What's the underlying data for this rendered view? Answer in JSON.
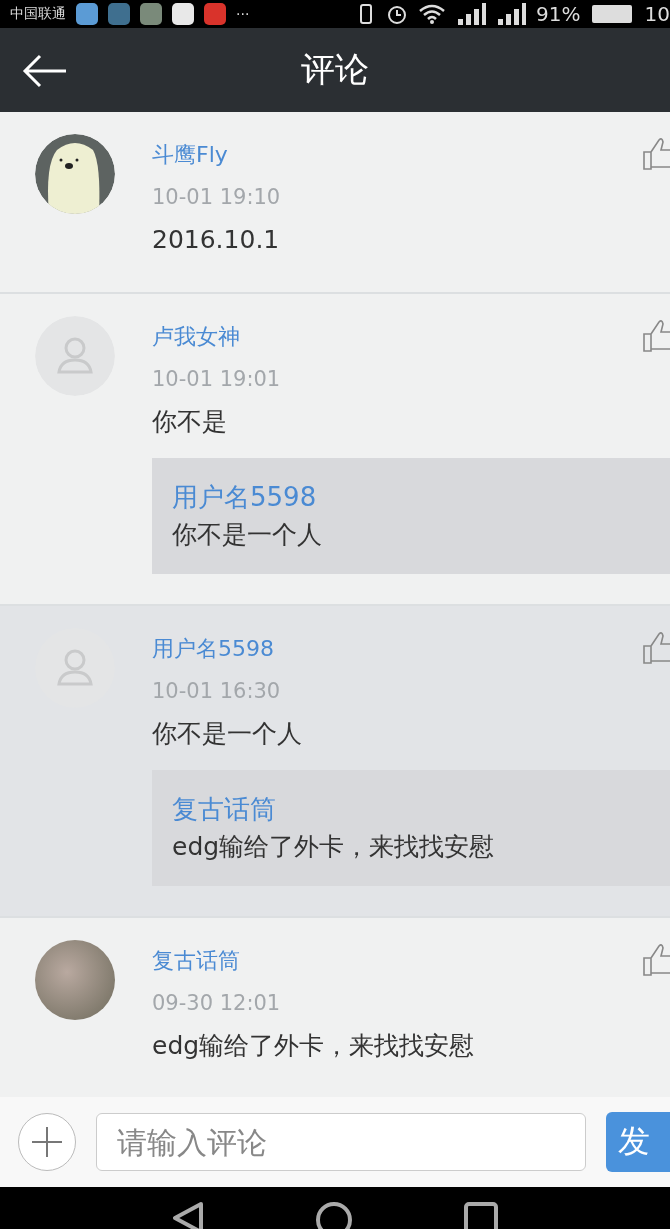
{
  "status_bar": {
    "carrier": "中国联通",
    "more": "···",
    "battery": "91%",
    "time": "10"
  },
  "header": {
    "title": "评论"
  },
  "comments": [
    {
      "author": "斗鹰Fly",
      "time": "10-01 19:10",
      "text": "2016.10.1",
      "avatar": {
        "kind": "cartoon"
      },
      "highlighted": false
    },
    {
      "author": "卢我女神",
      "time": "10-01 19:01",
      "text": "你不是",
      "avatar": {
        "kind": "default"
      },
      "highlighted": false,
      "reply": {
        "author": "用户名5598",
        "text": "你不是一个人"
      }
    },
    {
      "author": "用户名5598",
      "time": "10-01 16:30",
      "text": "你不是一个人",
      "avatar": {
        "kind": "default"
      },
      "highlighted": true,
      "reply": {
        "author": "复古话筒",
        "text": "edg输给了外卡，来找找安慰"
      }
    },
    {
      "author": "复古话筒",
      "time": "09-30 12:01",
      "text": "edg输给了外卡，来找找安慰",
      "avatar": {
        "kind": "photo"
      },
      "highlighted": false
    }
  ],
  "composer": {
    "placeholder": "请输入评论",
    "send": "发"
  }
}
